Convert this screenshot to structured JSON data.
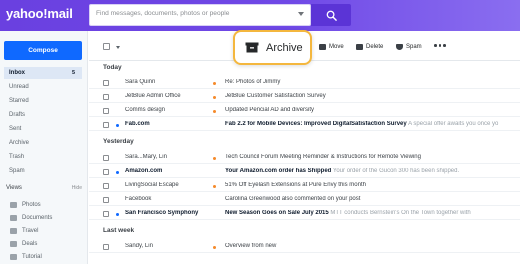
{
  "header": {
    "logo": "yahoo!mail",
    "search_placeholder": "Find messages, documents, photos or people"
  },
  "sidebar": {
    "compose_label": "Compose",
    "folders": [
      {
        "label": "Inbox",
        "count": "5"
      },
      {
        "label": "Unread"
      },
      {
        "label": "Starred"
      },
      {
        "label": "Drafts"
      },
      {
        "label": "Sent"
      },
      {
        "label": "Archive"
      },
      {
        "label": "Trash"
      },
      {
        "label": "Spam"
      }
    ],
    "views_label": "Views",
    "views_hide": "Hide",
    "views": [
      {
        "label": "Photos"
      },
      {
        "label": "Documents"
      },
      {
        "label": "Travel"
      },
      {
        "label": "Deals"
      },
      {
        "label": "Tutorial"
      }
    ]
  },
  "toolbar": {
    "archive_label": "Archive",
    "move_label": "Move",
    "delete_label": "Delete",
    "spam_label": "Spam"
  },
  "messages": {
    "sections": [
      "Today",
      "Yesterday",
      "Last week"
    ],
    "rows": [
      {
        "sender": "Sara Quinn",
        "subject": "Re: Photos of Jimmy",
        "preview": ""
      },
      {
        "sender": "JetBlue Admin Office",
        "subject": "JetBlue Customer Satisfaction Survey",
        "preview": ""
      },
      {
        "sender": "Comms design",
        "subject": "Updated Pencial AD and diversity",
        "preview": ""
      },
      {
        "sender": "Fab.com",
        "subject": "Fab 2.2 for Mobile Devices: Improved DigitalSatisfaction Survey",
        "preview": "A special offer awaits you once yo"
      },
      {
        "sender": "Sara...Mary, Lin",
        "subject": "Tech Council Forum Meeting Reminder & Instructions for Remote Viewing",
        "preview": ""
      },
      {
        "sender": "Amazon.com",
        "subject": "Your Amazon.com order has Shipped",
        "preview": "Your order of the Gucon 300 has been shipped."
      },
      {
        "sender": "LivingSocial Escape",
        "subject": "51% Off Eyelash Extensions at Pure Envy this month",
        "preview": ""
      },
      {
        "sender": "Facebook",
        "subject": "Carolina Greenwood also commented on your post",
        "preview": ""
      },
      {
        "sender": "San Francisco Symphony",
        "subject": "New Season Goes on Sale July 2015",
        "preview": "MTT conducts Bernstein's On the Town together with"
      },
      {
        "sender": "Sandy, Lin",
        "subject": "Overview from new",
        "preview": ""
      }
    ]
  }
}
